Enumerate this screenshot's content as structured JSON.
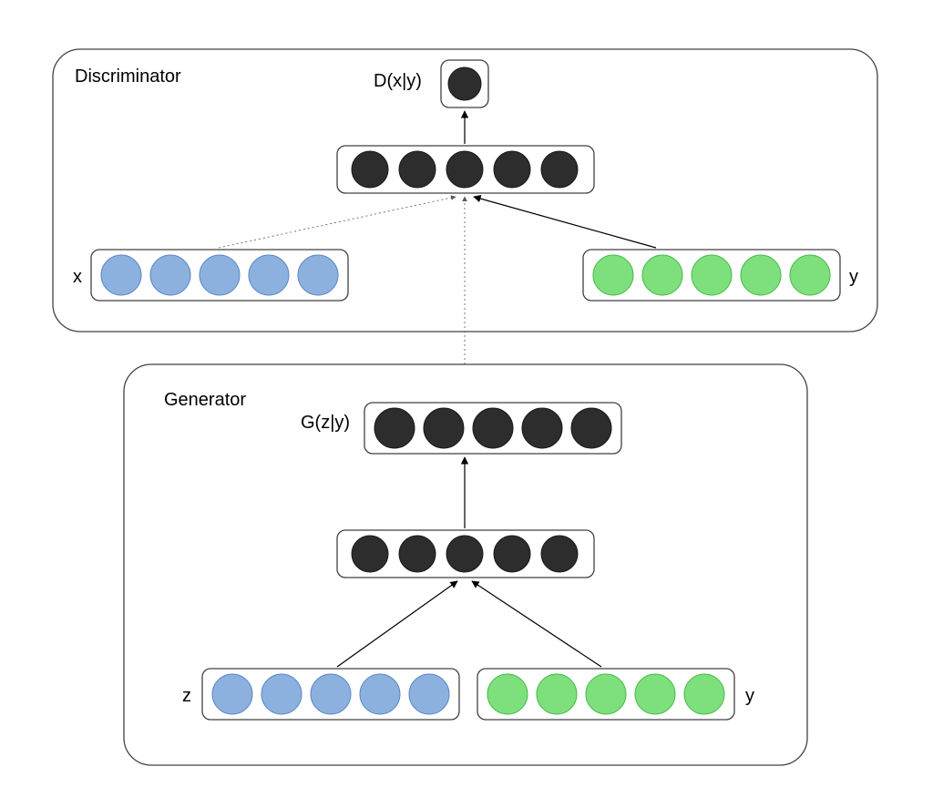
{
  "diagram": {
    "panels": {
      "discriminator": {
        "title": "Discriminator"
      },
      "generator": {
        "title": "Generator"
      }
    },
    "labels": {
      "d_output": "D(x|y)",
      "g_output": "G(z|y)",
      "x": "x",
      "y_top": "y",
      "z": "z",
      "y_bottom": "y"
    },
    "layers": {
      "d_output": {
        "color": "dark",
        "count": 1
      },
      "d_hidden": {
        "color": "dark",
        "count": 5
      },
      "d_input_x": {
        "color": "blue",
        "count": 5
      },
      "d_input_y": {
        "color": "green",
        "count": 5
      },
      "g_output": {
        "color": "dark",
        "count": 5
      },
      "g_hidden": {
        "color": "dark",
        "count": 5
      },
      "g_input_z": {
        "color": "blue",
        "count": 5
      },
      "g_input_y": {
        "color": "green",
        "count": 5
      }
    },
    "colors": {
      "dark": "#2d2d2d",
      "blue": "#8cb1de",
      "green": "#7de07d",
      "stroke": "#424242"
    },
    "arrows": [
      {
        "from": "d_hidden",
        "to": "d_output",
        "style": "solid"
      },
      {
        "from": "d_input_x",
        "to": "d_hidden",
        "style": "dotted"
      },
      {
        "from": "d_input_y",
        "to": "d_hidden",
        "style": "solid"
      },
      {
        "from": "g_output",
        "to": "d_hidden",
        "style": "dotted"
      },
      {
        "from": "g_hidden",
        "to": "g_output",
        "style": "solid"
      },
      {
        "from": "g_input_z",
        "to": "g_hidden",
        "style": "solid"
      },
      {
        "from": "g_input_y",
        "to": "g_hidden",
        "style": "solid"
      }
    ]
  }
}
